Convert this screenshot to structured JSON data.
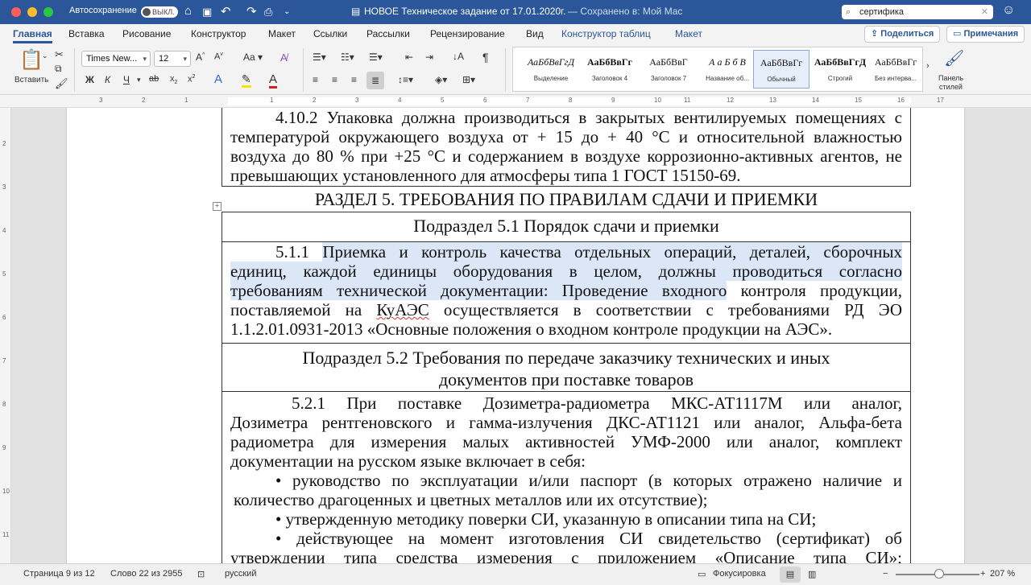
{
  "titlebar": {
    "autosave_label": "Автосохранение",
    "autosave_state": "ВЫКЛ.",
    "doc_title": "НОВОЕ Техническое задание от 17.01.2020г.",
    "saved_status": "— Сохранено в: Мой Mac",
    "search_value": "сертифика"
  },
  "tabs": [
    "Главная",
    "Вставка",
    "Рисование",
    "Конструктор",
    "Макет",
    "Ссылки",
    "Рассылки",
    "Рецензирование",
    "Вид",
    "Конструктор таблиц",
    "Макет"
  ],
  "share_label": "Поделиться",
  "comments_label": "Примечания",
  "ribbon": {
    "paste_label": "Вставить",
    "font_name": "Times New...",
    "font_size": "12",
    "styles": [
      {
        "preview": "АаБбВвГгД",
        "name": "Выделение"
      },
      {
        "preview": "АаБбВвГг",
        "name": "Заголовок 4"
      },
      {
        "preview": "АаБбВвГ",
        "name": "Заголовок 7"
      },
      {
        "preview": "А а Б б В",
        "name": "Название об..."
      },
      {
        "preview": "АаБбВвГг",
        "name": "Обычный"
      },
      {
        "preview": "АаБбВвГгД",
        "name": "Строгий"
      },
      {
        "preview": "АаБбВвГг",
        "name": "Без интерва..."
      }
    ],
    "styles_pane_label_1": "Панель",
    "styles_pane_label_2": "стилей"
  },
  "ruler_numbers": [
    "3",
    "2",
    "1",
    "1",
    "2",
    "3",
    "4",
    "5",
    "6",
    "7",
    "8",
    "9",
    "10",
    "11",
    "12",
    "13",
    "14",
    "15",
    "16",
    "17"
  ],
  "vruler_numbers": [
    "2",
    "3",
    "4",
    "5",
    "6",
    "7",
    "8",
    "9",
    "10",
    "11"
  ],
  "document": {
    "p_4_10_2": [
      "4.10.2 Упаковка должна производиться в закрытых вентилируемых помещениях с",
      "температурой окружающего воздуха от + 15 до + 40 °С и относительной влажностью",
      "воздуха до 80 % при +25 °С и содержанием в воздухе коррозионно-активных агентов, не",
      "превышающих установленного для атмосферы типа 1 ГОСТ 15150-69."
    ],
    "section5_title": "РАЗДЕЛ 5. ТРЕБОВАНИЯ ПО ПРАВИЛАМ СДАЧИ И ПРИЕМКИ",
    "sub51_title": "Подраздел 5.1 Порядок сдачи и приемки",
    "p511": {
      "num": "5.1.1",
      "l1": "Приемка и контроль качества отдельных операций, деталей, сборочных",
      "l2": "единиц, каждой единицы оборудования в целом, должны проводиться согласно",
      "l3_hl": "требованиям технической документации: Проведение входного",
      "l3_rest": " контроля продукции,",
      "l4_a": "поставляемой на ",
      "l4_spell": "КуАЭС",
      "l4_b": " осуществляется в соответствии с требованиями РД ЭО",
      "l5": "1.1.2.01.0931-2013 «Основные положения о входном контроле продукции на АЭС»."
    },
    "sub52_title_1": "Подраздел 5.2 Требования по передаче заказчику технических и иных",
    "sub52_title_2": "документов при поставке товаров",
    "p521": [
      "5.2.1 При поставке Дозиметра-радиометра МКС-АТ1117М или аналог,",
      "Дозиметра рентгеновского и гамма-излучения ДКС-АТ1121 или аналог, Альфа-бета",
      "радиометра для измерения малых активностей УМФ-2000 или аналог, комплект",
      "документации на русском языке включает в себя:"
    ],
    "bullet1": [
      "• руководство по эксплуатации и/или паспорт (в которых отражено наличие и",
      "количество драгоценных и цветных металлов или их отсутствие);"
    ],
    "bullet2": "• утвержденную методику поверки СИ, указанную в описании типа на СИ;",
    "bullet3": [
      "• действующее на момент изготовления СИ свидетельство (сертификат) об",
      "утверждении типа средства измерения с приложением «Описание типа СИ»;"
    ]
  },
  "statusbar": {
    "page": "Страница 9 из 12",
    "words": "Слово 22 из 2955",
    "language": "русский",
    "focus": "Фокусировка",
    "zoom": "207 %"
  }
}
